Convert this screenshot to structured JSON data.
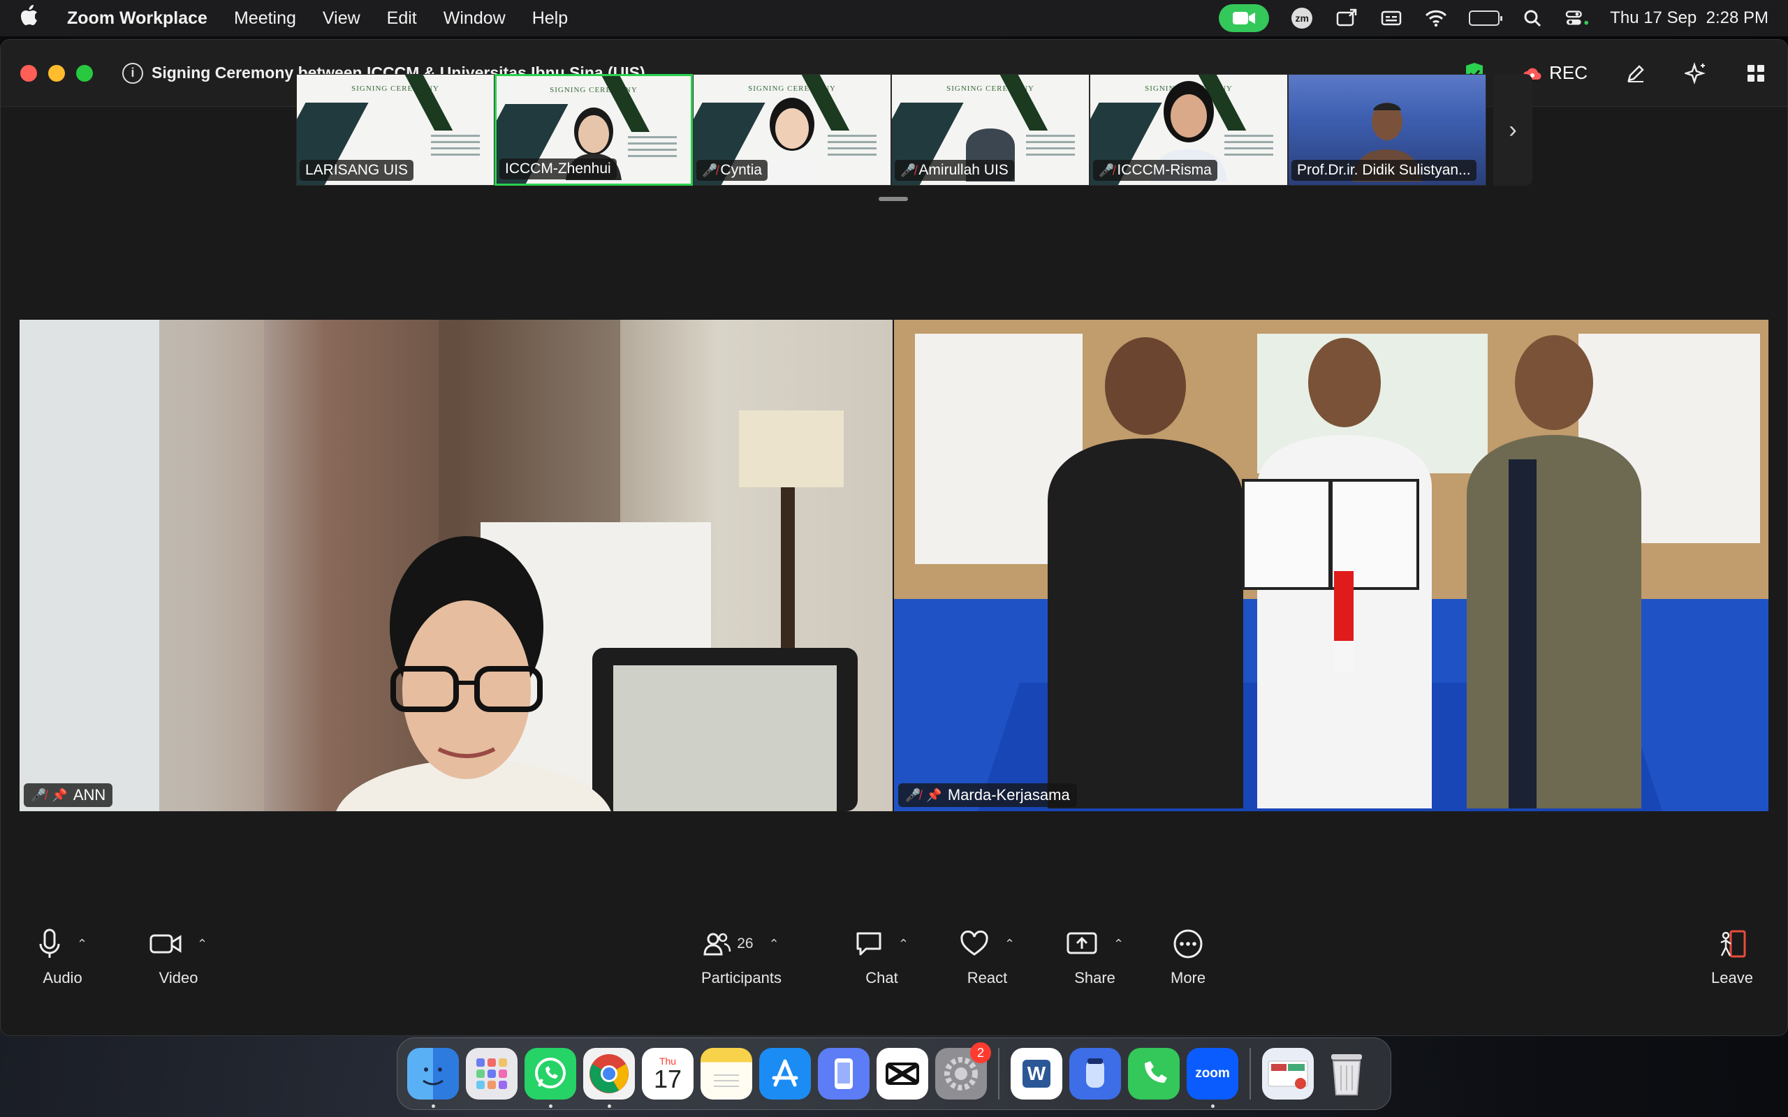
{
  "menubar": {
    "app_name": "Zoom Workplace",
    "items": [
      "Meeting",
      "View",
      "Edit",
      "Window",
      "Help"
    ],
    "clock": "Thu 17 Sep  2:28 PM",
    "zm_label": "zm"
  },
  "window": {
    "title": "Signing Ceremony between ICCCM & Universitas Ibnu Sina (UIS)",
    "rec_label": "REC",
    "accent_green": "#2bd14f"
  },
  "filmstrip": {
    "slide_header": "SIGNING CEREMONY",
    "participants": [
      {
        "name": "LARISANG UIS",
        "muted": false
      },
      {
        "name": "ICCCM-Zhenhui",
        "muted": false
      },
      {
        "name": "Cyntia",
        "muted": true
      },
      {
        "name": "Amirullah UIS",
        "muted": true
      },
      {
        "name": "ICCCM-Risma",
        "muted": true
      },
      {
        "name": "Prof.Dr.ir. Didik Sulistyan...",
        "muted": false
      }
    ]
  },
  "videos": {
    "left_name": "ANN",
    "right_name": "Marda-Kerjasama"
  },
  "toolbar": {
    "audio": "Audio",
    "video": "Video",
    "participants": "Participants",
    "participants_count": "26",
    "chat": "Chat",
    "react": "React",
    "share": "Share",
    "more": "More",
    "leave": "Leave"
  },
  "dock": {
    "calendar_month": "Thu",
    "calendar_day": "17",
    "settings_badge": "2",
    "zoom_label": "zoom",
    "word_label": "W"
  }
}
